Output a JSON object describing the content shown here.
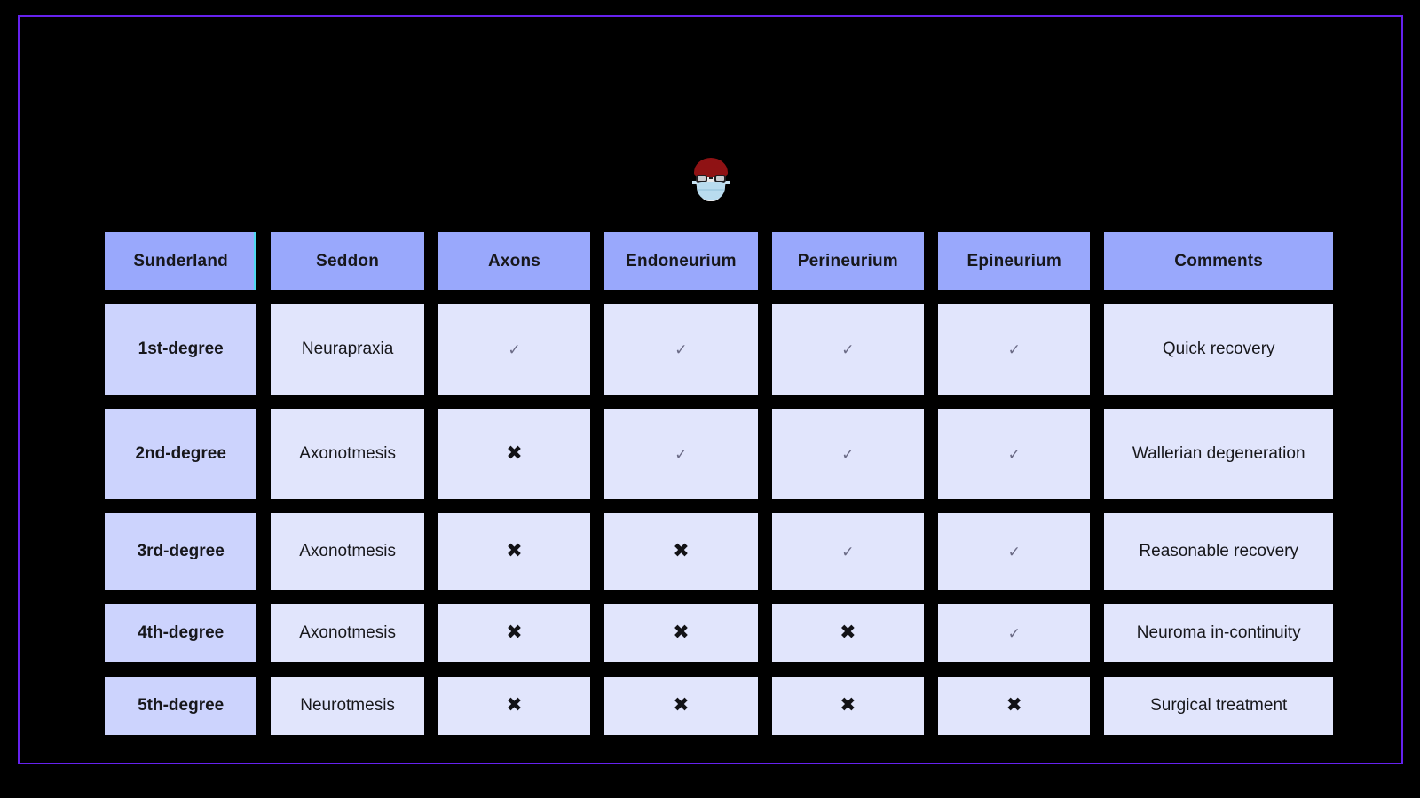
{
  "slide": {
    "background_color": "#000000",
    "border_color": "#6622ee"
  },
  "avatar": {
    "icon_name": "doctor-face-with-medical-mask",
    "hair_color": "#8f1214",
    "mask_color": "#b9dcef",
    "skin_color": "#e8e9ea"
  },
  "theme": {
    "header_fill": "#99a8fc",
    "first_column_fill": "#ccd3fd",
    "body_fill": "#e1e5fc",
    "accent_line": "#4ed8ef",
    "text_color": "#17171b"
  },
  "table": {
    "headers": [
      "Sunderland",
      "Seddon",
      "Axons",
      "Endoneurium",
      "Perineurium",
      "Epineurium",
      "Comments"
    ],
    "marks": {
      "intact": "✓",
      "disrupted": "✖"
    },
    "rows": [
      {
        "sunderland": "1st-degree",
        "seddon": "Neurapraxia",
        "axons": "✓",
        "endoneurium": "✓",
        "perineurium": "✓",
        "epineurium": "✓",
        "comments": "Quick recovery"
      },
      {
        "sunderland": "2nd-degree",
        "seddon": "Axonotmesis",
        "axons": "✖",
        "endoneurium": "✓",
        "perineurium": "✓",
        "epineurium": "✓",
        "comments": "Wallerian degeneration"
      },
      {
        "sunderland": "3rd-degree",
        "seddon": "Axonotmesis",
        "axons": "✖",
        "endoneurium": "✖",
        "perineurium": "✓",
        "epineurium": "✓",
        "comments": "Reasonable recovery"
      },
      {
        "sunderland": "4th-degree",
        "seddon": "Axonotmesis",
        "axons": "✖",
        "endoneurium": "✖",
        "perineurium": "✖",
        "epineurium": "✓",
        "comments": "Neuroma in-continuity"
      },
      {
        "sunderland": "5th-degree",
        "seddon": "Neurotmesis",
        "axons": "✖",
        "endoneurium": "✖",
        "perineurium": "✖",
        "epineurium": "✖",
        "comments": "Surgical treatment"
      }
    ]
  }
}
